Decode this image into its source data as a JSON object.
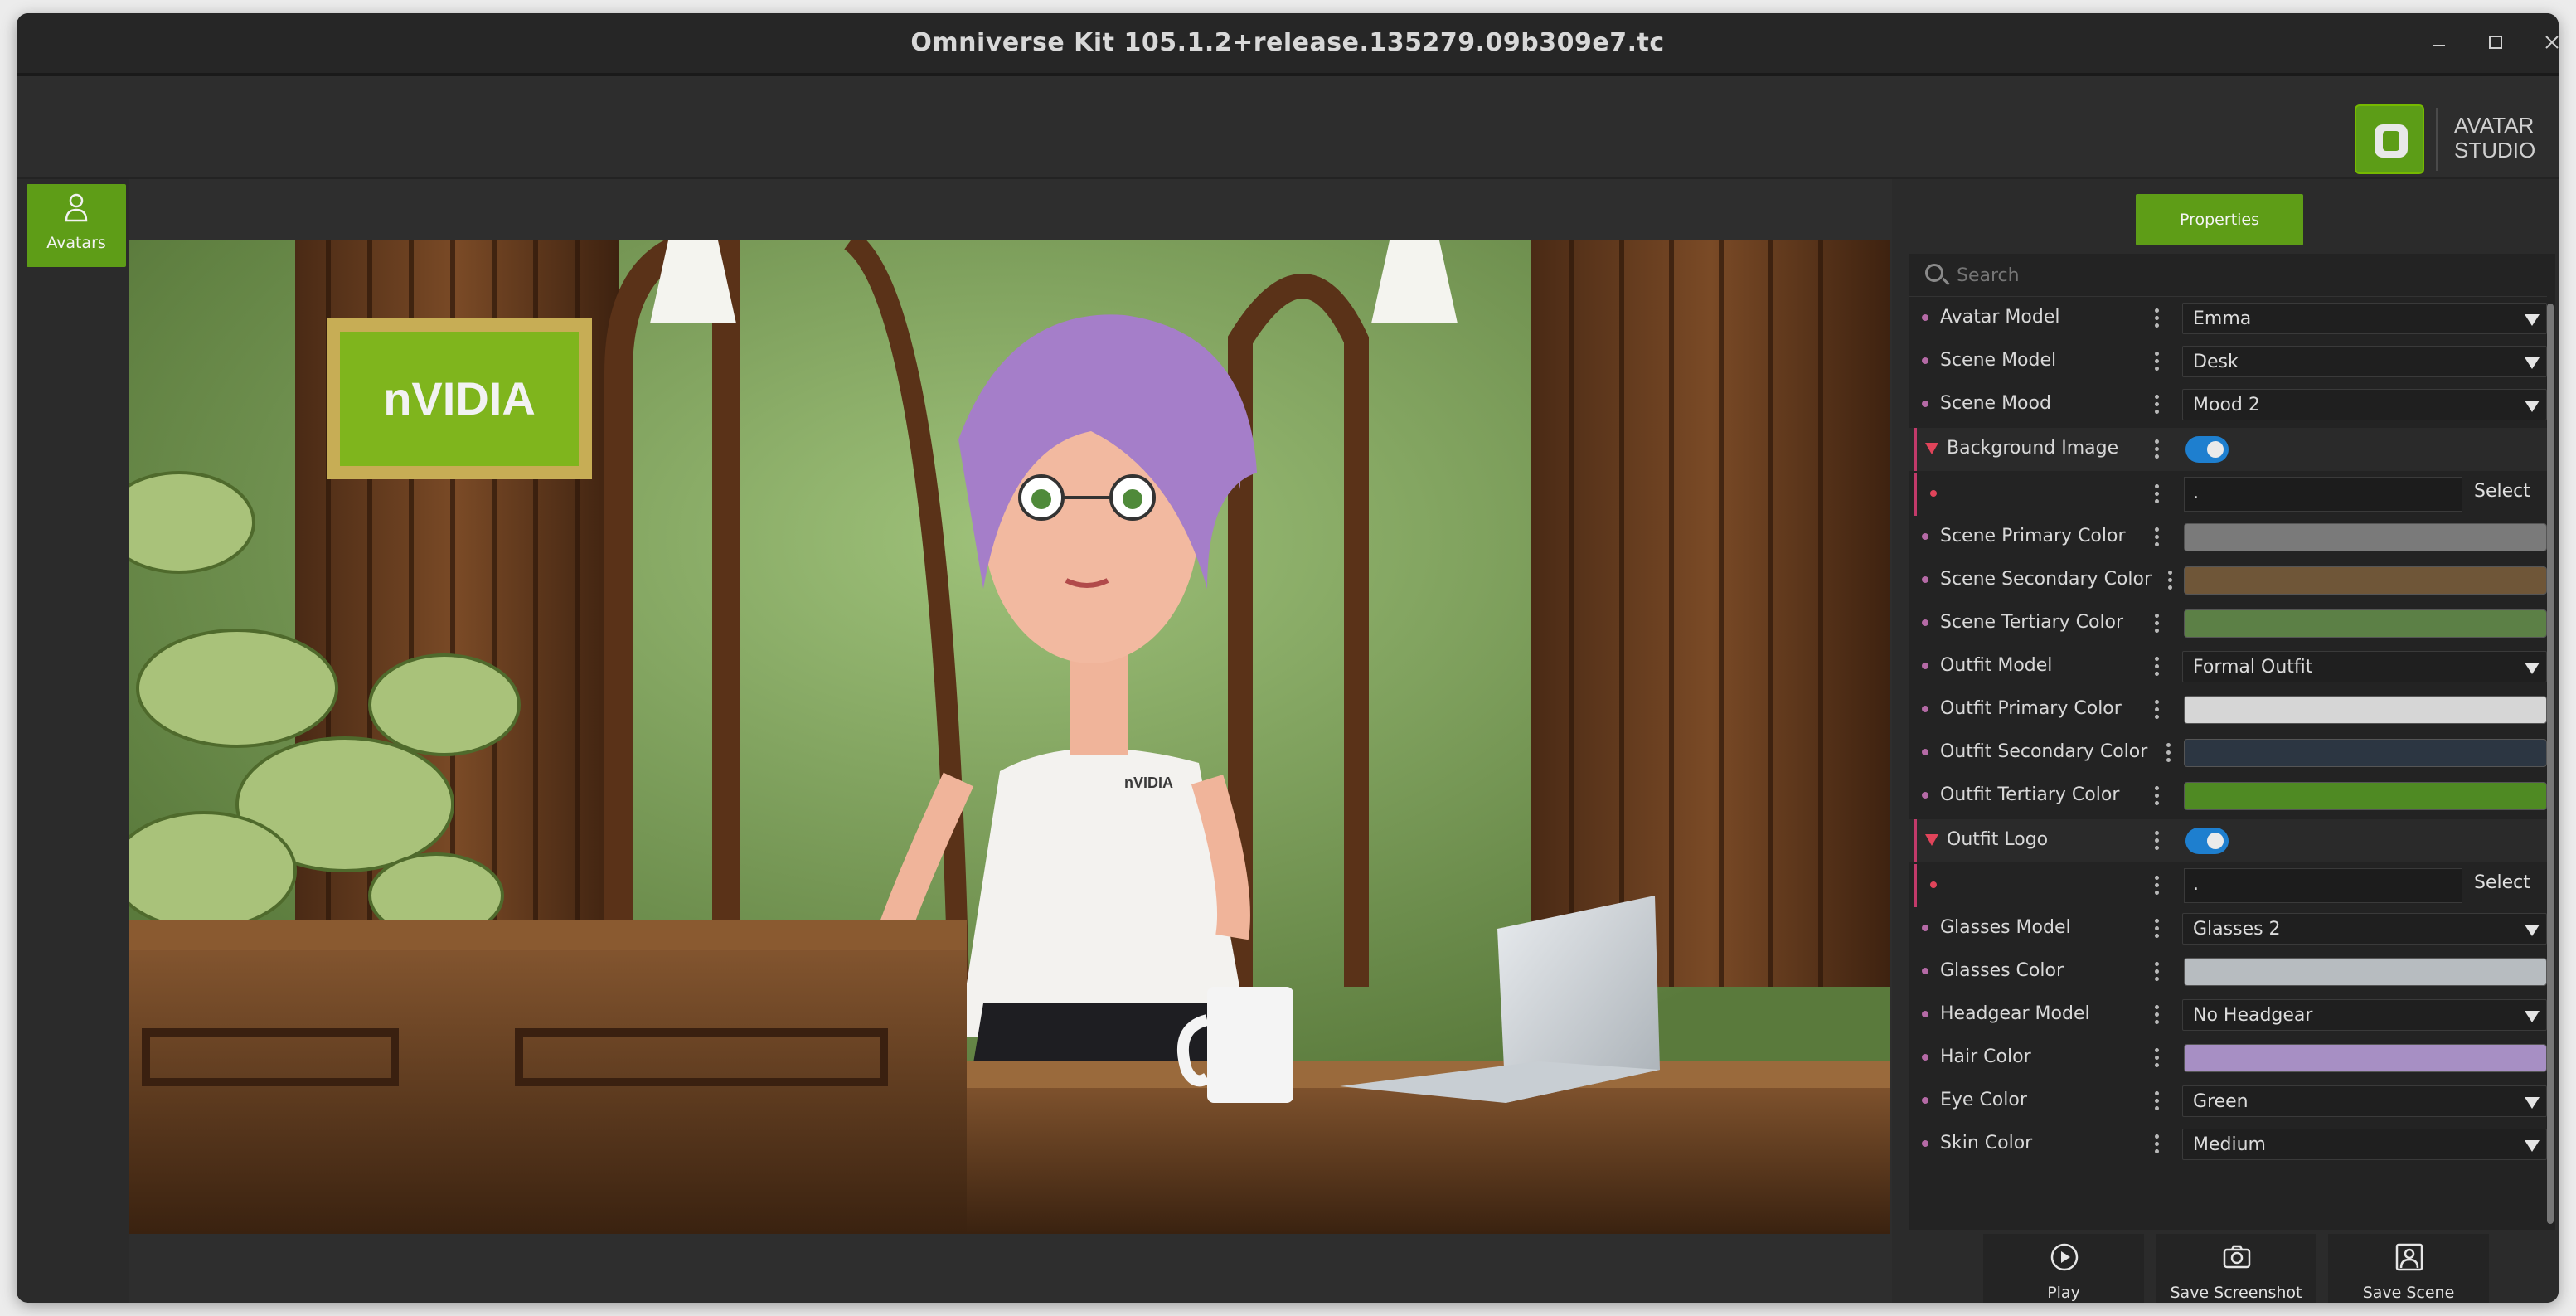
{
  "window": {
    "title": "Omniverse Kit 105.1.2+release.135279.09b309e7.tc"
  },
  "brand": {
    "line1": "AVATAR",
    "line2": "STUDIO"
  },
  "leftbar": {
    "avatars_label": "Avatars"
  },
  "panel": {
    "tab": "Properties",
    "search_placeholder": "Search",
    "rows": {
      "avatar_model": {
        "label": "Avatar Model",
        "value": "Emma"
      },
      "scene_model": {
        "label": "Scene Model",
        "value": "Desk"
      },
      "scene_mood": {
        "label": "Scene Mood",
        "value": "Mood 2"
      },
      "background_image": {
        "label": "Background Image",
        "enabled": true,
        "path": ".",
        "select_label": "Select"
      },
      "scene_primary_color": {
        "label": "Scene Primary Color",
        "color": "#7a7a7a"
      },
      "scene_secondary_color": {
        "label": "Scene Secondary Color",
        "color": "#6f5638"
      },
      "scene_tertiary_color": {
        "label": "Scene Tertiary Color",
        "color": "#5c8046"
      },
      "outfit_model": {
        "label": "Outfit Model",
        "value": "Formal Outfit"
      },
      "outfit_primary_color": {
        "label": "Outfit Primary Color",
        "color": "#d6d6d6"
      },
      "outfit_secondary_color": {
        "label": "Outfit Secondary Color",
        "color": "#2c3642"
      },
      "outfit_tertiary_color": {
        "label": "Outfit Tertiary Color",
        "color": "#4f8a23"
      },
      "outfit_logo": {
        "label": "Outfit Logo",
        "enabled": true,
        "path": ".",
        "select_label": "Select"
      },
      "glasses_model": {
        "label": "Glasses Model",
        "value": "Glasses 2"
      },
      "glasses_color": {
        "label": "Glasses Color",
        "color": "#b7bcc0"
      },
      "headgear_model": {
        "label": "Headgear Model",
        "value": "No Headgear"
      },
      "hair_color": {
        "label": "Hair Color",
        "color": "#a78fc4"
      },
      "eye_color": {
        "label": "Eye Color",
        "value": "Green"
      },
      "skin_color": {
        "label": "Skin Color",
        "value": "Medium"
      }
    }
  },
  "actions": {
    "play": "Play",
    "save_screenshot": "Save Screenshot",
    "save_scene": "Save Scene"
  },
  "viewport": {
    "sign_text": "nVIDIA",
    "shirt_logo_text": "nVIDIA"
  },
  "colors": {
    "accent_green": "#5e9d17",
    "toggle_blue": "#1e7fcf"
  }
}
